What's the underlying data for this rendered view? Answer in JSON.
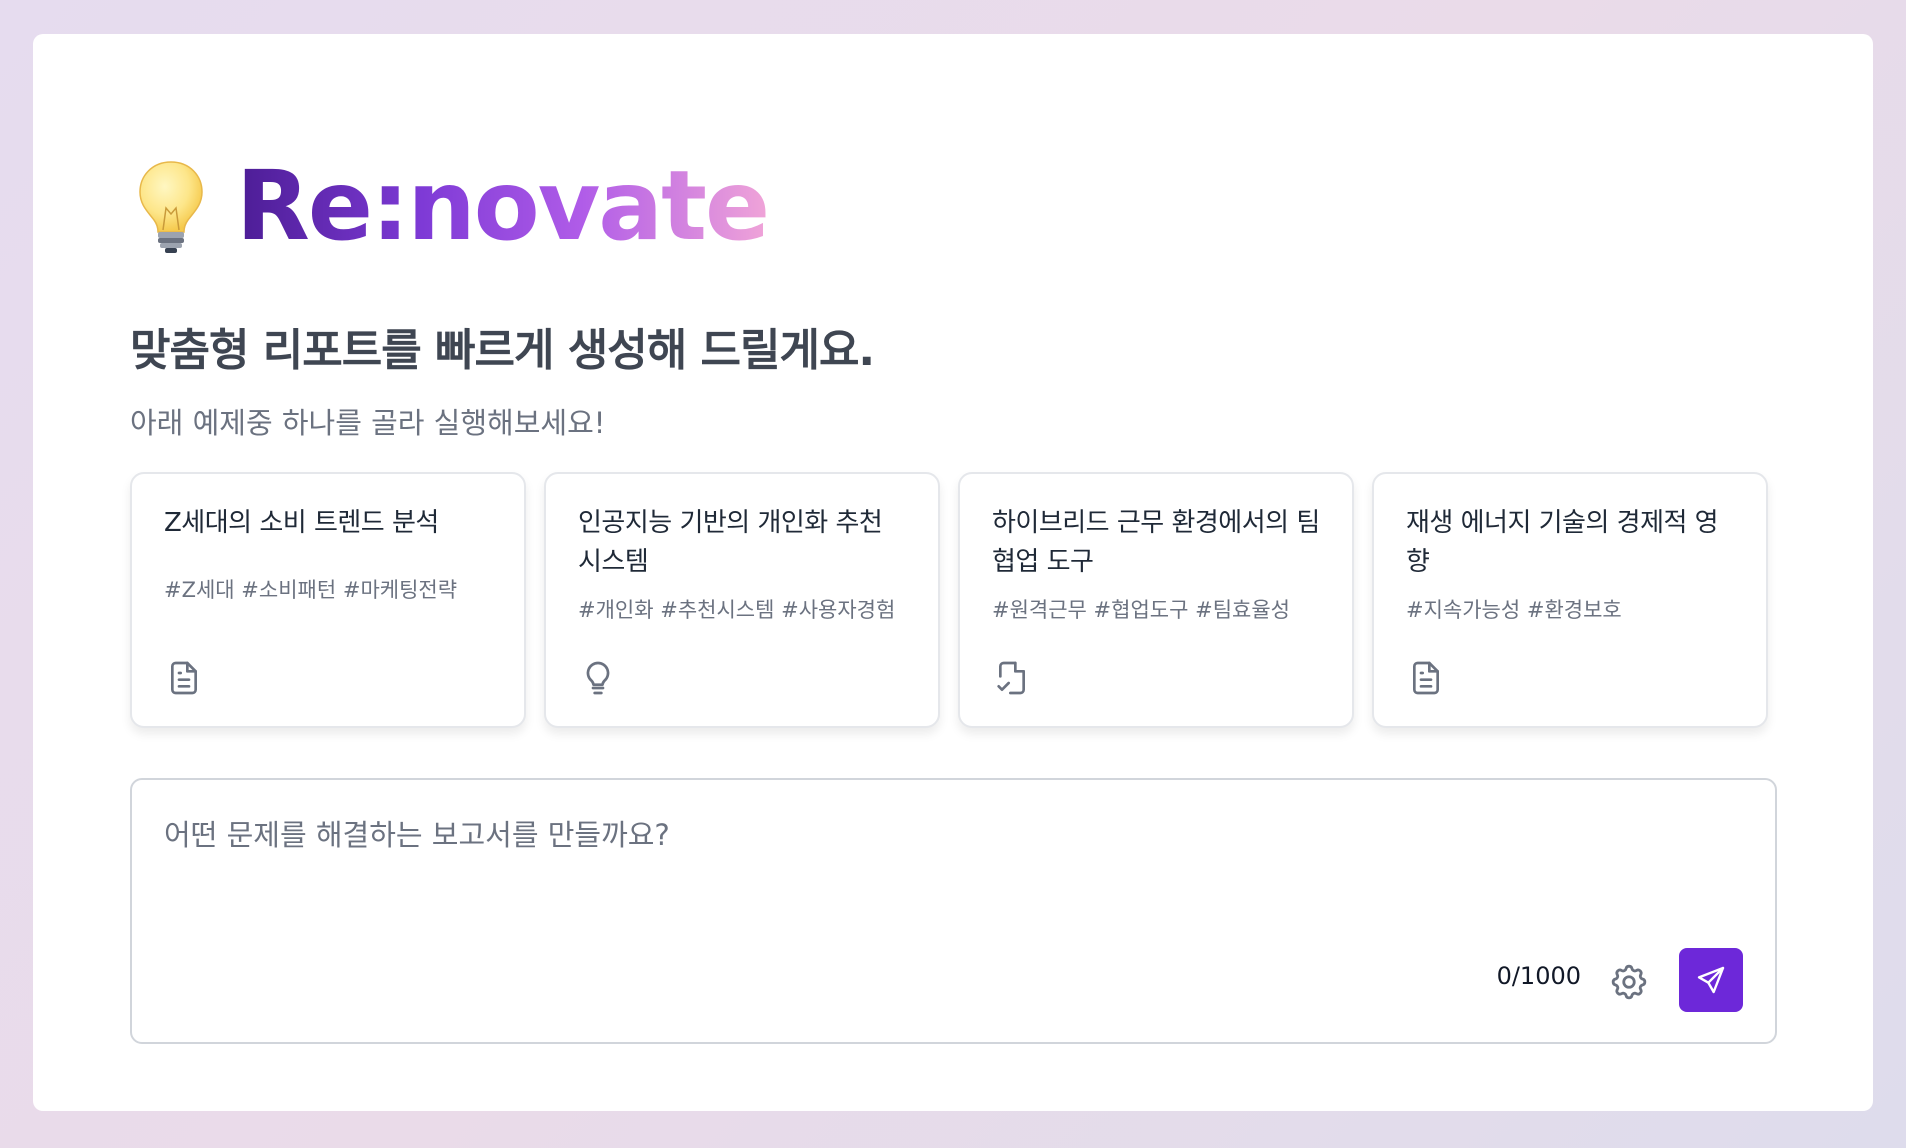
{
  "brand": {
    "icon": "lightbulb-emoji",
    "title": "Re:novate",
    "gradient": [
      "#4c1d95",
      "#7e3ad6",
      "#b05ce8",
      "#f0a4d8"
    ]
  },
  "headline": "맞춤형 리포트를 빠르게 생성해 드릴게요.",
  "subline": "아래 예제중 하나를 골라 실행해보세요!",
  "examples": [
    {
      "title": "Z세대의 소비 트렌드 분석",
      "tags": "#Z세대 #소비패턴 #마케팅전략",
      "icon": "document-icon"
    },
    {
      "title": "인공지능 기반의 개인화 추천 시스템",
      "tags": "#개인화 #추천시스템 #사용자경험",
      "icon": "lightbulb-icon"
    },
    {
      "title": "하이브리드 근무 환경에서의 팀 협업 도구",
      "tags": "#원격근무 #협업도구 #팀효율성",
      "icon": "document-check-icon"
    },
    {
      "title": "재생 에너지 기술의 경제적 영향",
      "tags": "#지속가능성 #환경보호",
      "icon": "document-icon"
    }
  ],
  "composer": {
    "placeholder": "어떤 문제를 해결하는 보고서를 만들까요?",
    "value": "",
    "counter": "0/1000",
    "settings_icon": "gear-icon",
    "send_icon": "send-icon"
  },
  "colors": {
    "accent": "#6d28d9",
    "text_muted": "#6b7280",
    "headline": "#3f4652"
  }
}
